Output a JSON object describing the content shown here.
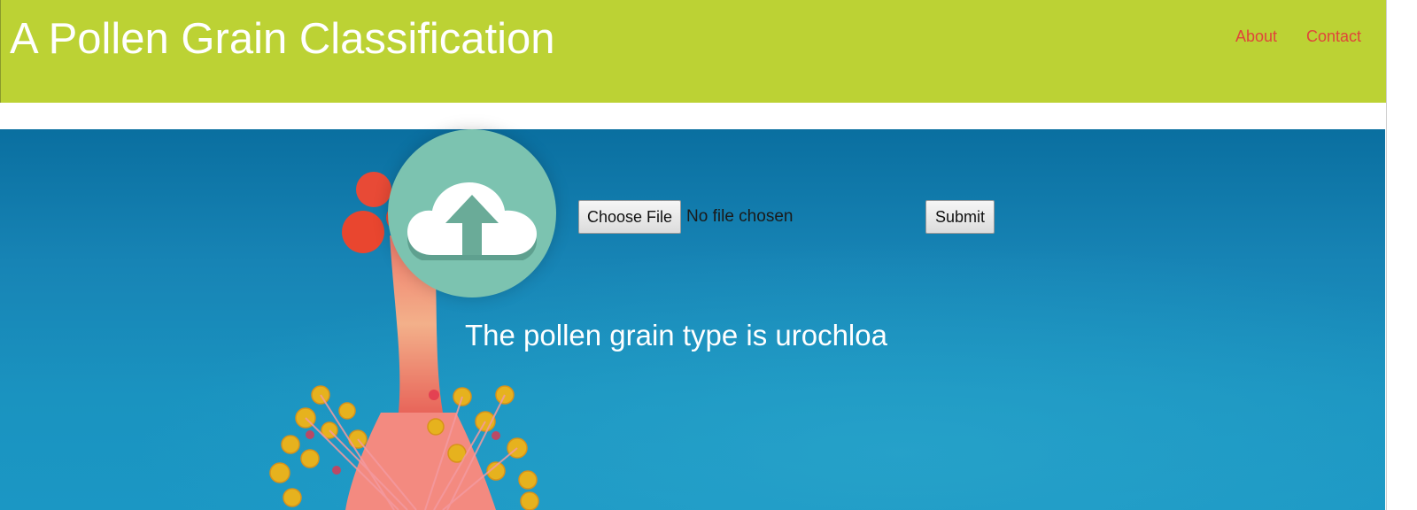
{
  "header": {
    "title": "A Pollen Grain Classification",
    "nav": [
      {
        "label": "About"
      },
      {
        "label": "Contact"
      }
    ],
    "background_color": "#bcd234",
    "title_color": "#ffffff",
    "nav_link_color": "#e0453a"
  },
  "upload": {
    "icon": "cloud-upload-icon",
    "icon_circle_color": "#7cc3b0",
    "choose_file_label": "Choose File",
    "file_status": "No file chosen",
    "submit_label": "Submit"
  },
  "result": {
    "text": "The pollen grain type is urochloa"
  },
  "hero": {
    "background": "hibiscus-flower-stamen-photo",
    "sky_color": "#1784b5"
  }
}
